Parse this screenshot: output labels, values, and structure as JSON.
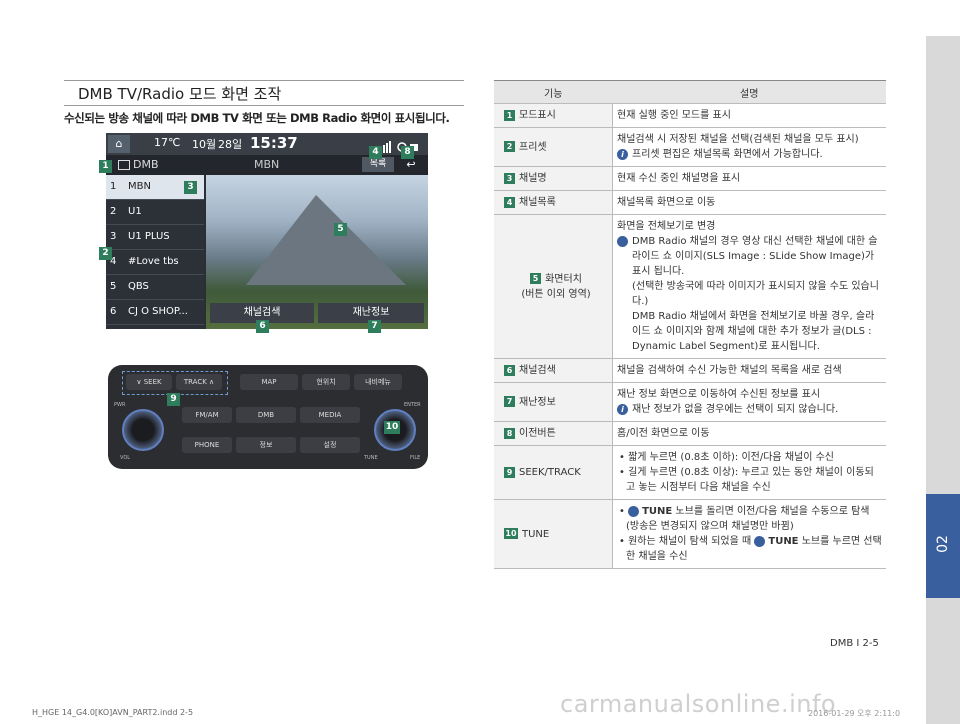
{
  "side_tab": {
    "label": "02"
  },
  "section": {
    "title": "DMB TV/Radio 모드 화면 조작",
    "subtitle": "수신되는 방송 채널에 따라 DMB TV 화면 또는 DMB Radio 화면이 표시됩니다."
  },
  "screen": {
    "temp": "17℃",
    "date_month": "10월",
    "date_day": "28일",
    "time": "15:37",
    "mode": "DMB",
    "channel_name": "MBN",
    "list_button": "목록",
    "back_symbol": "↩",
    "channels": [
      {
        "n": "1",
        "t": "MBN"
      },
      {
        "n": "2",
        "t": "U1"
      },
      {
        "n": "3",
        "t": "U1 PLUS"
      },
      {
        "n": "4",
        "t": "#Love tbs"
      },
      {
        "n": "5",
        "t": "QBS"
      },
      {
        "n": "6",
        "t": "CJ O SHOP..."
      }
    ],
    "scan_button": "채널검색",
    "info_button": "재난정보"
  },
  "badges": [
    "1",
    "2",
    "3",
    "4",
    "5",
    "6",
    "7",
    "8",
    "9",
    "10"
  ],
  "panel": {
    "seek": "∨ SEEK",
    "track": "TRACK ∧",
    "map": "MAP",
    "current": "현위치",
    "navi_menu": "내비메뉴",
    "fm_am": "FM/AM",
    "dmb": "DMB",
    "media": "MEDIA",
    "phone": "PHONE",
    "info": "정보",
    "setup": "설정",
    "enter": "ENTER",
    "vol": "VOL",
    "tune": "TUNE",
    "file": "FILE",
    "power": "PWR"
  },
  "table": {
    "header_func": "기능",
    "header_desc": "설명",
    "rows": [
      {
        "num": "1",
        "func": "모드표시",
        "desc": [
          "현재 실행 중인 모드를 표시"
        ]
      },
      {
        "num": "2",
        "func": "프리셋",
        "desc": [
          "채널검색 시 저장된 채널을 선택(검색된 채널을 모두 표시)"
        ],
        "info": "프리셋 편집은 채널목록 화면에서 가능합니다."
      },
      {
        "num": "3",
        "func": "채널명",
        "desc": [
          "현재 수신 중인 채널명을 표시"
        ]
      },
      {
        "num": "4",
        "func": "채널목록",
        "desc": [
          "채널목록 화면으로 이동"
        ]
      },
      {
        "num": "5",
        "func": "화면터치",
        "func2": "(버튼 이외 영역)",
        "desc": [
          "화면을 전체보기로 변경"
        ],
        "info": "DMB Radio 채널의 경우 영상 대신 선택한 채널에 대한 슬라이드 쇼 이미지(SLS Image : SLide Show Image)가 표시 됩니다.",
        "info_more": [
          "(선택한 방송국에 따라 이미지가 표시되지 않을 수도 있습니다.)",
          "DMB Radio 채널에서 화면을 전체보기로 바꿀 경우, 슬라이드 쇼 이미지와 함께 채널에 대한 추가 정보가 글(DLS : Dynamic Label Segment)로 표시됩니다."
        ]
      },
      {
        "num": "6",
        "func": "채널검색",
        "desc": [
          "채널을 검색하여 수신 가능한 채널의 목록을 새로 검색"
        ]
      },
      {
        "num": "7",
        "func": "재난정보",
        "desc": [
          "재난 정보 화면으로 이동하여 수신된 정보를 표시"
        ],
        "info": "재난 정보가 없을 경우에는 선택이 되지 않습니다."
      },
      {
        "num": "8",
        "func": "이전버튼",
        "desc": [
          "홈/이전 화면으로 이동"
        ]
      },
      {
        "num": "9",
        "func": "SEEK/TRACK",
        "bullets": [
          "짧게 누르면 (0.8초 이하): 이전/다음 채널이 수신",
          "길게 누르면 (0.8초 이상): 누르고 있는 동안 채널이 이동되고 놓는 시점부터 다음 채널을 수신"
        ]
      },
      {
        "num": "10",
        "func": "TUNE",
        "tune_bullets": [
          {
            "pre": "",
            "strong": "TUNE",
            "post": " 노브를 돌리면 이전/다음 채널을 수동으로 탐색 (방송은 변경되지 않으며 채널명만 바뀜)"
          },
          {
            "pre": "원하는 채널이 탐색 되었을 때 ",
            "strong": "TUNE",
            "post": " 노브를 누르면 선택한 채널을 수신"
          }
        ]
      }
    ]
  },
  "footer": {
    "page": "DMB I 2-5",
    "file": "H_HGE 14_G4.0[KO]AVN_PART2.indd   2-5",
    "stamp": "2016-01-29   오후 2:11:0",
    "watermark": "carmanualsonline.info"
  }
}
